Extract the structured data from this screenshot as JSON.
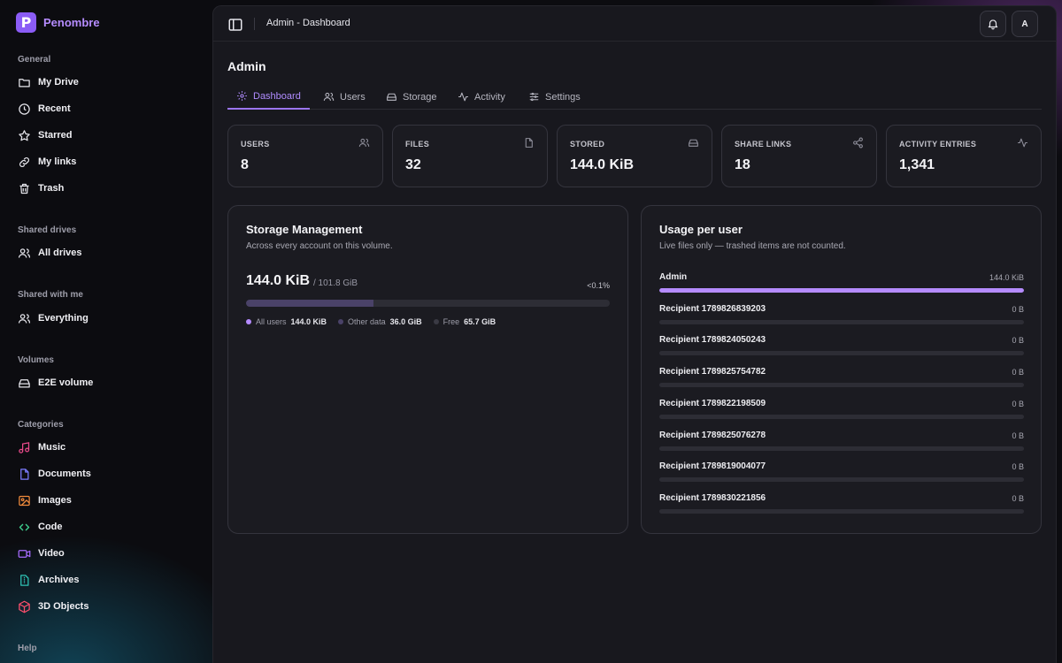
{
  "brand": {
    "name": "Penombre",
    "logo_letter": "P"
  },
  "sidebar": {
    "general_title": "General",
    "general": [
      {
        "label": "My Drive",
        "icon": "folder-icon"
      },
      {
        "label": "Recent",
        "icon": "clock-icon"
      },
      {
        "label": "Starred",
        "icon": "star-icon"
      },
      {
        "label": "My links",
        "icon": "link-icon"
      },
      {
        "label": "Trash",
        "icon": "trash-icon"
      }
    ],
    "shared_drives_title": "Shared drives",
    "shared_drives": [
      {
        "label": "All drives",
        "icon": "users-icon"
      }
    ],
    "shared_with_me_title": "Shared with me",
    "shared_with_me": [
      {
        "label": "Everything",
        "icon": "users-icon"
      }
    ],
    "volumes_title": "Volumes",
    "volumes": [
      {
        "label": "E2E volume",
        "icon": "drive-icon"
      }
    ],
    "categories_title": "Categories",
    "categories": [
      {
        "label": "Music",
        "icon": "music-icon",
        "color": "#e84a8a"
      },
      {
        "label": "Documents",
        "icon": "document-icon",
        "color": "#7c7cff"
      },
      {
        "label": "Images",
        "icon": "image-icon",
        "color": "#f08a3c"
      },
      {
        "label": "Code",
        "icon": "code-icon",
        "color": "#3ecf8e"
      },
      {
        "label": "Video",
        "icon": "video-icon",
        "color": "#a66bff"
      },
      {
        "label": "Archives",
        "icon": "archive-icon",
        "color": "#2ec4b6"
      },
      {
        "label": "3D Objects",
        "icon": "cube-icon",
        "color": "#ff4f6d"
      }
    ],
    "help_title": "Help"
  },
  "topbar": {
    "breadcrumb": "Admin - Dashboard",
    "avatar_initial": "A"
  },
  "page": {
    "title": "Admin"
  },
  "tabs": [
    {
      "label": "Dashboard",
      "icon": "gear-icon",
      "active": true
    },
    {
      "label": "Users",
      "icon": "users-icon"
    },
    {
      "label": "Storage",
      "icon": "drive-icon"
    },
    {
      "label": "Activity",
      "icon": "activity-icon"
    },
    {
      "label": "Settings",
      "icon": "sliders-icon"
    }
  ],
  "stats": [
    {
      "label": "USERS",
      "value": "8",
      "icon": "users-icon"
    },
    {
      "label": "FILES",
      "value": "32",
      "icon": "file-icon"
    },
    {
      "label": "STORED",
      "value": "144.0 KiB",
      "icon": "drive-icon"
    },
    {
      "label": "SHARE LINKS",
      "value": "18",
      "icon": "share-icon"
    },
    {
      "label": "ACTIVITY ENTRIES",
      "value": "1,341",
      "icon": "activity-icon"
    }
  ],
  "storage": {
    "title": "Storage Management",
    "subtitle": "Across every account on this volume.",
    "used": "144.0 KiB",
    "total": "/ 101.8 GiB",
    "percent": "<0.1%",
    "bar_fraction": 0.35,
    "legend": [
      {
        "name": "All users",
        "value": "144.0 KiB",
        "color": "#b58bff"
      },
      {
        "name": "Other data",
        "value": "36.0 GiB",
        "color": "#4a4268"
      },
      {
        "name": "Free",
        "value": "65.7 GiB",
        "color": "#3a3a44"
      }
    ]
  },
  "usage": {
    "title": "Usage per user",
    "subtitle": "Live files only — trashed items are not counted.",
    "users": [
      {
        "name": "Admin",
        "size": "144.0 KiB",
        "fraction": 1.0
      },
      {
        "name": "Recipient 1789826839203",
        "size": "0 B",
        "fraction": 0
      },
      {
        "name": "Recipient 1789824050243",
        "size": "0 B",
        "fraction": 0
      },
      {
        "name": "Recipient 1789825754782",
        "size": "0 B",
        "fraction": 0
      },
      {
        "name": "Recipient 1789822198509",
        "size": "0 B",
        "fraction": 0
      },
      {
        "name": "Recipient 1789825076278",
        "size": "0 B",
        "fraction": 0
      },
      {
        "name": "Recipient 1789819004077",
        "size": "0 B",
        "fraction": 0
      },
      {
        "name": "Recipient 1789830221856",
        "size": "0 B",
        "fraction": 0
      }
    ]
  }
}
